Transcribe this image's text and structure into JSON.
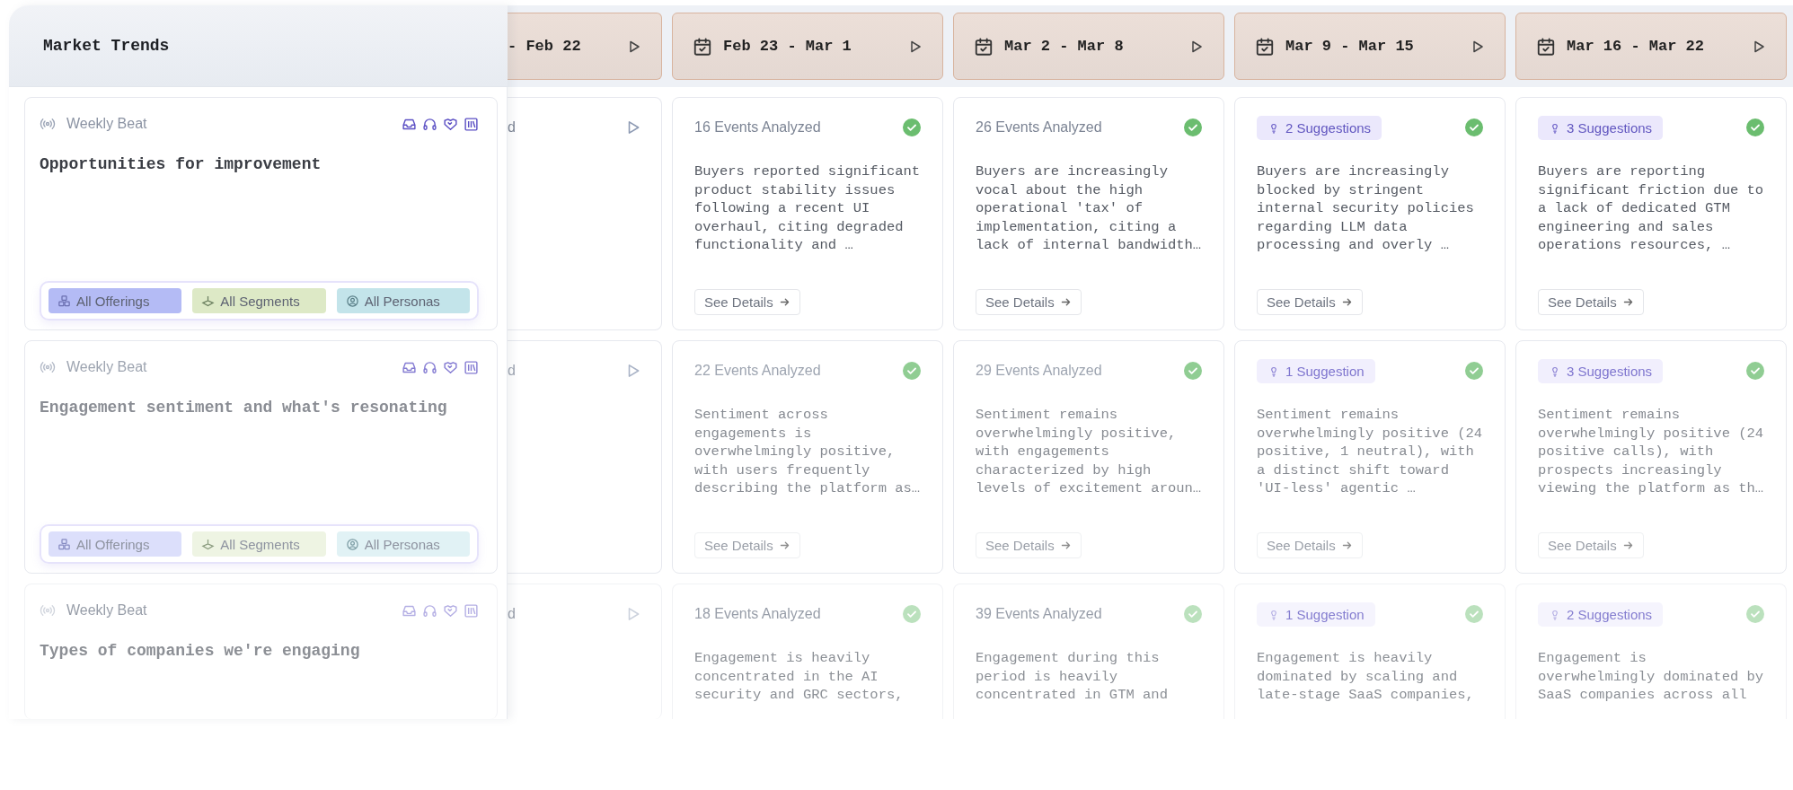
{
  "panel": {
    "title": "Market Trends"
  },
  "weeks": [
    {
      "label": "- Feb 22",
      "kind": "cut"
    },
    {
      "label": "Feb 23 - Mar 1",
      "kind": "full"
    },
    {
      "label": "Mar 2 - Mar 8",
      "kind": "full"
    },
    {
      "label": "Mar 9 - Mar 15",
      "kind": "full"
    },
    {
      "label": "Mar 16 - Mar 22",
      "kind": "full"
    }
  ],
  "rows": [
    {
      "beat": "Weekly Beat",
      "title": "Opportunities for improvement",
      "filters": [
        {
          "label": "All Offerings",
          "kind": "offerings",
          "color": "#b4bbf5"
        },
        {
          "label": "All Segments",
          "kind": "segments",
          "color": "#dde9c6"
        },
        {
          "label": "All Personas",
          "kind": "personas",
          "color": "#c3e4ea"
        }
      ],
      "cells": [
        {
          "kind": "cut",
          "count": "d",
          "done": false
        },
        {
          "kind": "events",
          "count": "16 Events Analyzed",
          "done": true,
          "summary": "Buyers reported significant product stability issues following a recent UI overhaul, citing degraded functionality and …",
          "action": "See Details"
        },
        {
          "kind": "events",
          "count": "26 Events Analyzed",
          "done": true,
          "summary": "Buyers are increasingly vocal about the high operational 'tax' of implementation, citing a lack of internal bandwidth…",
          "action": "See Details"
        },
        {
          "kind": "suggestions",
          "count": "2 Suggestions",
          "done": true,
          "summary": "Buyers are increasingly blocked by stringent internal security policies regarding LLM data processing and overly …",
          "action": "See Details"
        },
        {
          "kind": "suggestions",
          "count": "3 Suggestions",
          "done": true,
          "summary": "Buyers are reporting significant friction due to a lack of dedicated GTM engineering and sales operations resources, …",
          "action": "See Details"
        }
      ]
    },
    {
      "beat": "Weekly Beat",
      "title": "Engagement sentiment and what's resonating",
      "filters": [
        {
          "label": "All Offerings",
          "kind": "offerings",
          "color": "#dcdffb"
        },
        {
          "label": "All Segments",
          "kind": "segments",
          "color": "#eef4e3"
        },
        {
          "label": "All Personas",
          "kind": "personas",
          "color": "#e1f2f5"
        }
      ],
      "cells": [
        {
          "kind": "cut",
          "count": "d",
          "done": false
        },
        {
          "kind": "events",
          "count": "22 Events Analyzed",
          "done": true,
          "summary": "Sentiment across engagements is overwhelmingly positive, with users frequently describing the platform as…",
          "action": "See Details"
        },
        {
          "kind": "events",
          "count": "29 Events Analyzed",
          "done": true,
          "summary": "Sentiment remains overwhelmingly positive, with engagements characterized by high levels of excitement aroun…",
          "action": "See Details"
        },
        {
          "kind": "suggestions",
          "count": "1 Suggestion",
          "done": true,
          "summary": "Sentiment remains overwhelmingly positive (24 positive, 1 neutral), with a distinct shift toward 'UI-less' agentic …",
          "action": "See Details"
        },
        {
          "kind": "suggestions",
          "count": "3 Suggestions",
          "done": true,
          "summary": "Sentiment remains overwhelmingly positive (24 positive calls), with prospects increasingly viewing the platform as th…",
          "action": "See Details"
        }
      ]
    },
    {
      "beat": "Weekly Beat",
      "title": "Types of companies we're engaging",
      "cells": [
        {
          "kind": "cut",
          "count": "d",
          "done": false
        },
        {
          "kind": "events",
          "count": "18 Events Analyzed",
          "done": true,
          "summary": "Engagement is heavily concentrated in the AI security and GRC sectors,"
        },
        {
          "kind": "events",
          "count": "39 Events Analyzed",
          "done": true,
          "summary": "Engagement during this period is heavily concentrated in GTM and"
        },
        {
          "kind": "suggestions",
          "count": "1 Suggestion",
          "done": true,
          "summary": "Engagement is heavily dominated by scaling and late-stage SaaS companies,"
        },
        {
          "kind": "suggestions",
          "count": "2 Suggestions",
          "done": true,
          "summary": "Engagement is overwhelmingly dominated by SaaS companies across all"
        }
      ]
    }
  ]
}
